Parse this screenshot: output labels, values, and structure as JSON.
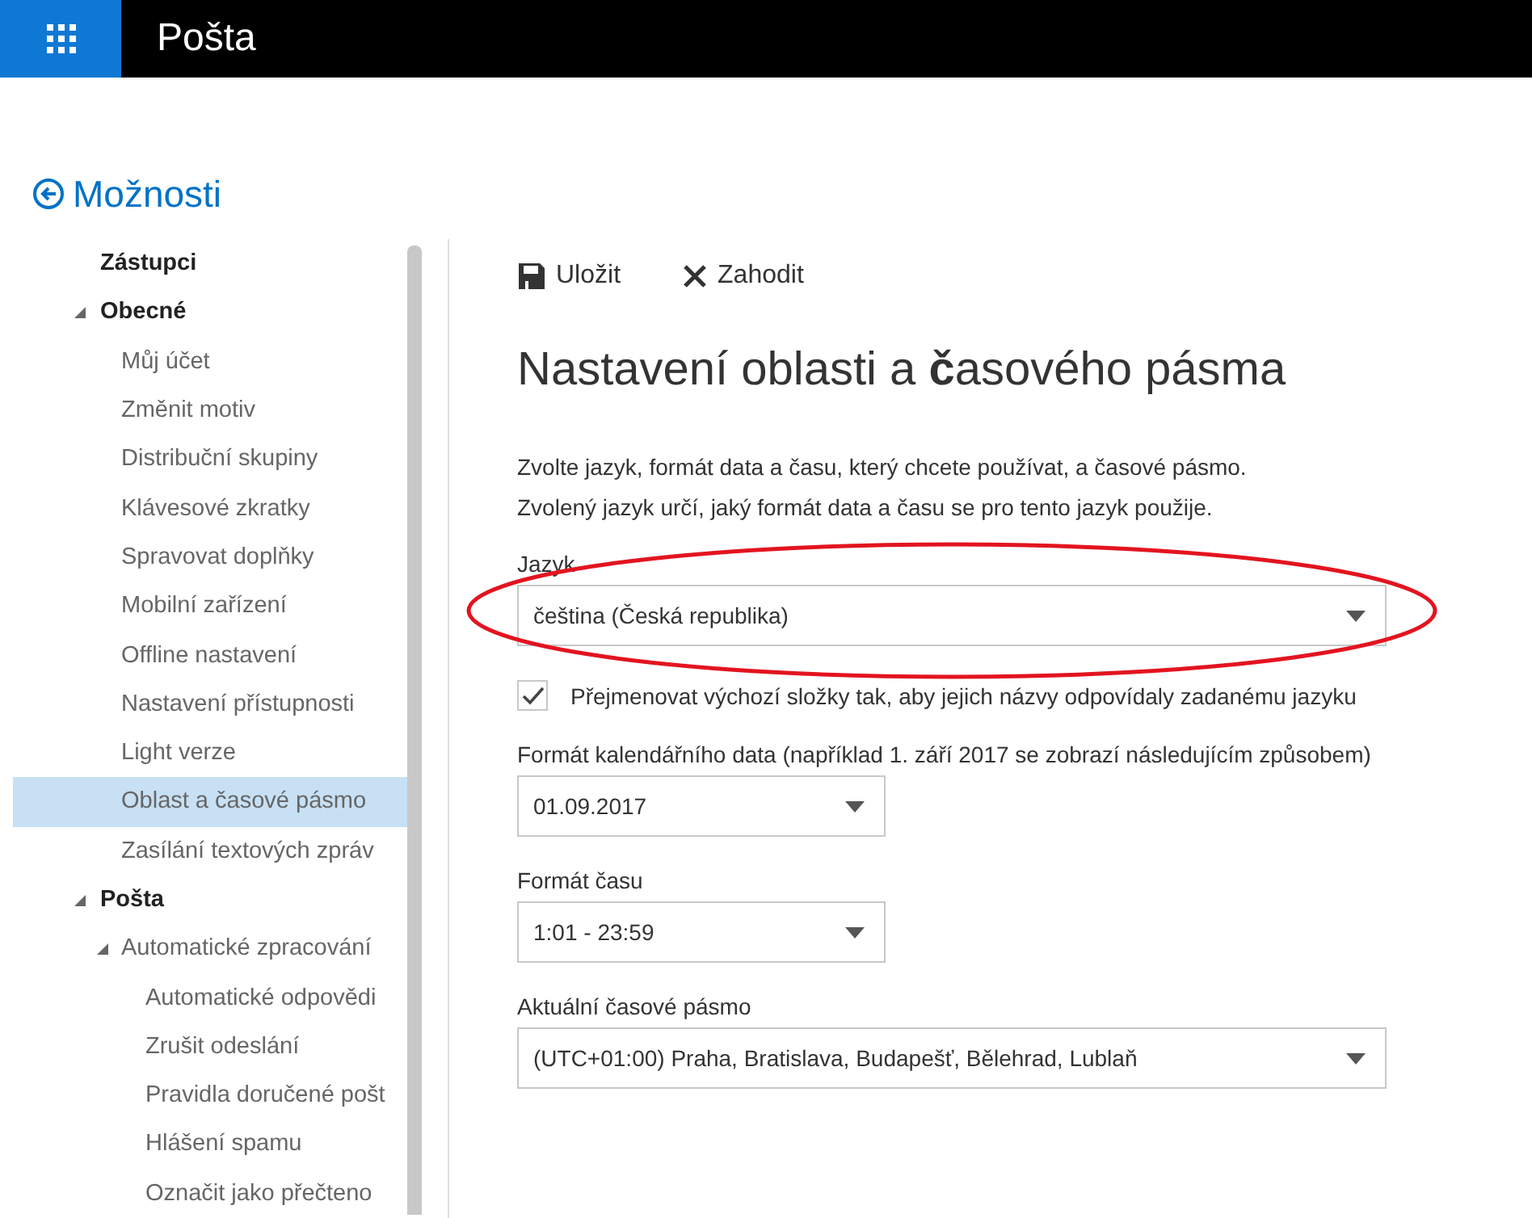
{
  "app_bar": {
    "title": "Pošta"
  },
  "back_link": {
    "label": "Možnosti"
  },
  "sidebar": {
    "items": [
      {
        "kind": "heading",
        "label": "Zástupci",
        "selected": false
      },
      {
        "kind": "group",
        "label": "Obecné",
        "expanded": true,
        "children": [
          {
            "kind": "item",
            "label": "Můj účet",
            "selected": false
          },
          {
            "kind": "item",
            "label": "Změnit motiv",
            "selected": false
          },
          {
            "kind": "item",
            "label": "Distribuční skupiny",
            "selected": false
          },
          {
            "kind": "item",
            "label": "Klávesové zkratky",
            "selected": false
          },
          {
            "kind": "item",
            "label": "Spravovat doplňky",
            "selected": false
          },
          {
            "kind": "item",
            "label": "Mobilní zařízení",
            "selected": false
          },
          {
            "kind": "item",
            "label": "Offline nastavení",
            "selected": false
          },
          {
            "kind": "item",
            "label": "Nastavení přístupnosti",
            "selected": false
          },
          {
            "kind": "item",
            "label": "Light verze",
            "selected": false
          },
          {
            "kind": "item",
            "label": "Oblast a časové pásmo",
            "selected": true
          },
          {
            "kind": "item",
            "label": "Zasílání textových zpráv",
            "selected": false
          }
        ]
      },
      {
        "kind": "group",
        "label": "Pošta",
        "expanded": true,
        "children": [
          {
            "kind": "group",
            "label": "Automatické zpracování",
            "expanded": true,
            "children": [
              {
                "kind": "item",
                "label": "Automatické odpovědi",
                "selected": false
              },
              {
                "kind": "item",
                "label": "Zrušit odeslání",
                "selected": false
              },
              {
                "kind": "item",
                "label": "Pravidla doručené pošt",
                "selected": false
              },
              {
                "kind": "item",
                "label": "Hlášení spamu",
                "selected": false
              },
              {
                "kind": "item",
                "label": "Označit jako přečteno",
                "selected": false
              }
            ]
          }
        ]
      }
    ]
  },
  "toolbar": [
    {
      "kind": "save",
      "label": "Uložit"
    },
    {
      "kind": "discard",
      "label": "Zahodit"
    }
  ],
  "page": {
    "title": "Nastavení oblasti a **č**asového pásma",
    "description": [
      "Zvolte jazyk, formát data a času, který chcete používat, a časové pásmo.",
      "Zvolený jazyk určí, jaký formát data a času se pro tento jazyk použije."
    ],
    "fields": [
      {
        "kind": "wide-select",
        "label": "Jazyk",
        "value": "čeština (Česká republika)",
        "circled": true
      },
      {
        "kind": "checkbox",
        "label": "Přejmenovat výchozí složky tak, aby jejich názvy odpovídaly zadanému jazyku",
        "checked": true
      },
      {
        "kind": "narrow-select",
        "label": "Formát kalendářního data (například 1. září 2017 se zobrazí následujícím způsobem)",
        "value": "01.09.2017",
        "circled": false
      },
      {
        "kind": "narrow-select",
        "label": "Formát času",
        "value": "1:01 - 23:59",
        "circled": false
      },
      {
        "kind": "wide-select",
        "label": "Aktuální časové pásmo",
        "value": "(UTC+01:00) Praha, Bratislava, Budapešť, Bělehrad, Lublaň",
        "circled": false
      }
    ]
  }
}
